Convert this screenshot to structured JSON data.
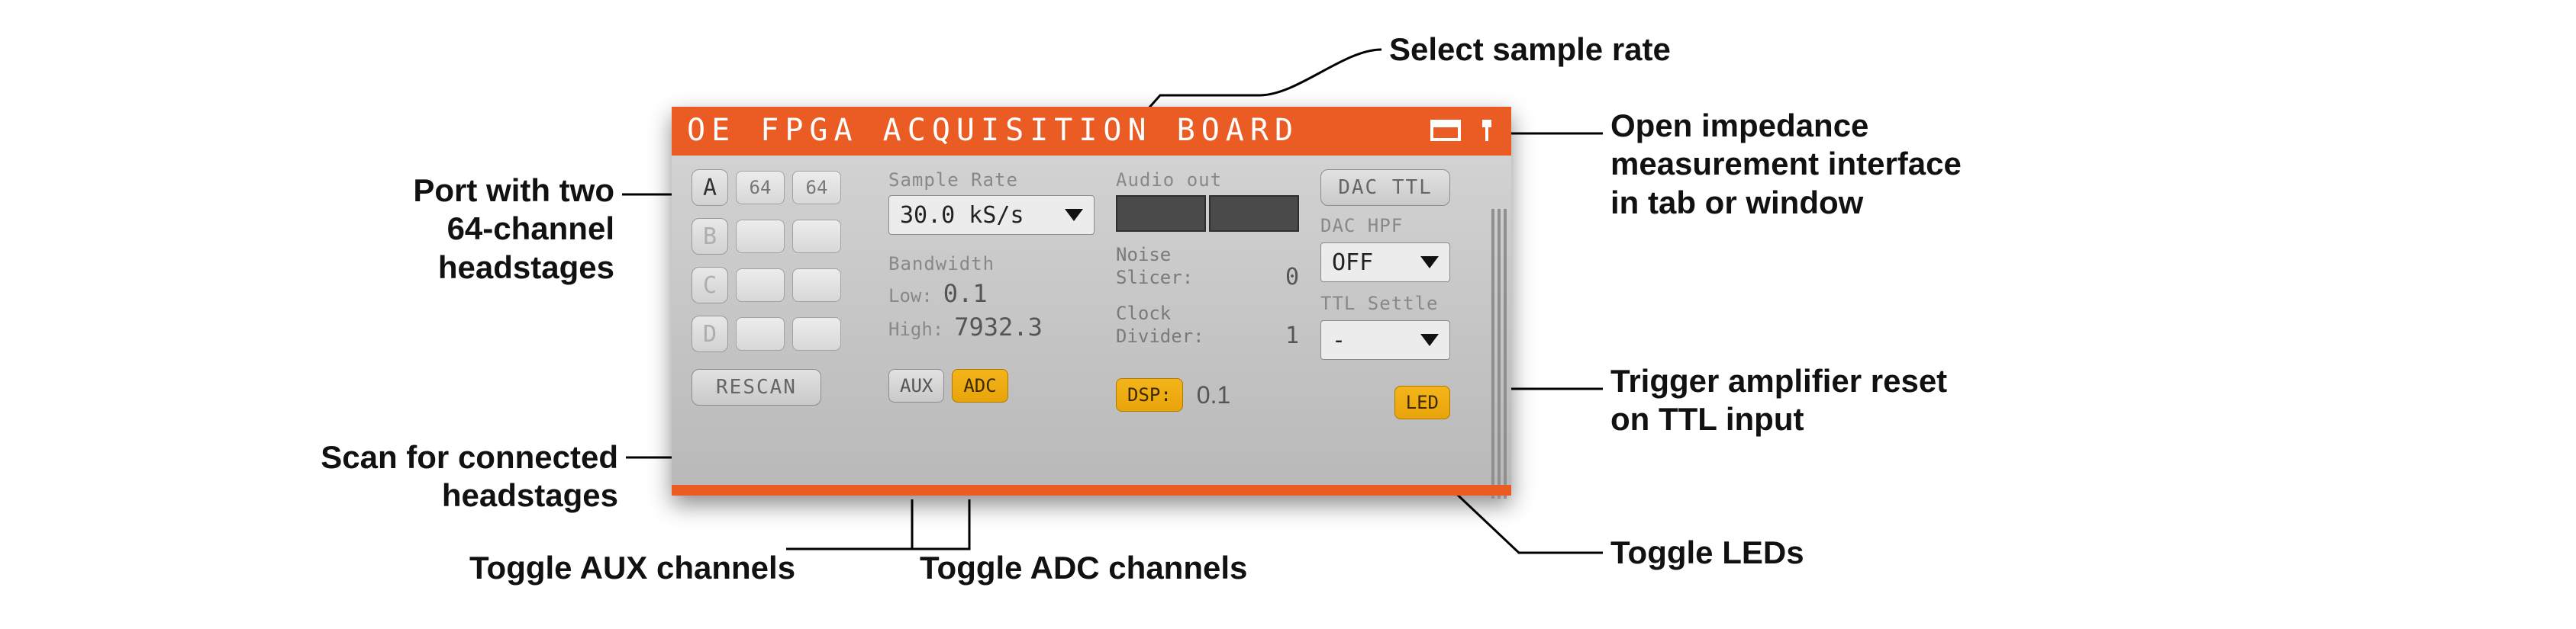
{
  "header": {
    "title": "OE FPGA ACQUISITION BOARD"
  },
  "ports": {
    "a": {
      "id": "A",
      "hs1": "64",
      "hs2": "64",
      "active": true
    },
    "b": {
      "id": "B",
      "hs1": "",
      "hs2": "",
      "active": false
    },
    "c": {
      "id": "C",
      "hs1": "",
      "hs2": "",
      "active": false
    },
    "d": {
      "id": "D",
      "hs1": "",
      "hs2": "",
      "active": false
    }
  },
  "rescan_label": "RESCAN",
  "sample_rate": {
    "label": "Sample Rate",
    "value": "30.0 kS/s"
  },
  "bandwidth": {
    "label": "Bandwidth",
    "low_label": "Low:",
    "low_value": "0.1",
    "high_label": "High:",
    "high_value": "7932.3"
  },
  "audio": {
    "label": "Audio out"
  },
  "noise_slicer": {
    "label1": "Noise",
    "label2": "Slicer:",
    "value": "0"
  },
  "clock_divider": {
    "label1": "Clock",
    "label2": "Divider:",
    "value": "1"
  },
  "dsp": {
    "label": "DSP:",
    "value": "0.1"
  },
  "dac_ttl": {
    "label": "DAC TTL"
  },
  "dac_hpf": {
    "label": "DAC HPF",
    "value": "OFF"
  },
  "ttl_settle": {
    "label": "TTL Settle",
    "value": "-"
  },
  "toggles": {
    "aux": "AUX",
    "adc": "ADC",
    "led": "LED"
  },
  "callouts": {
    "port": "Port with two\n64‑channel\nheadstages",
    "rescan": "Scan for connected\nheadstages",
    "aux": "Toggle AUX channels",
    "adc": "Toggle ADC channels",
    "sample_rate": "Select sample rate",
    "impedance": "Open impedance\nmeasurement interface\nin tab or window",
    "ttl_settle": "Trigger amplifier reset\non TTL input",
    "led": "Toggle LEDs"
  }
}
